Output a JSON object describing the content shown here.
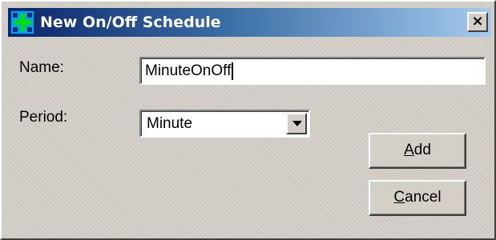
{
  "window": {
    "title": "New On/Off Schedule",
    "close_glyph": "×",
    "app_icon": "schedule-app-icon"
  },
  "form": {
    "name_label": "Name:",
    "name_value": "MinuteOnOff",
    "period_label": "Period:",
    "period_value": "Minute"
  },
  "buttons": {
    "add": {
      "mnemonic": "A",
      "rest": "dd"
    },
    "cancel": {
      "mnemonic": "C",
      "rest": "ancel"
    }
  },
  "colors": {
    "titlebar_start": "#0a246a",
    "titlebar_end": "#a6caf0",
    "face": "#d4d0c8"
  }
}
